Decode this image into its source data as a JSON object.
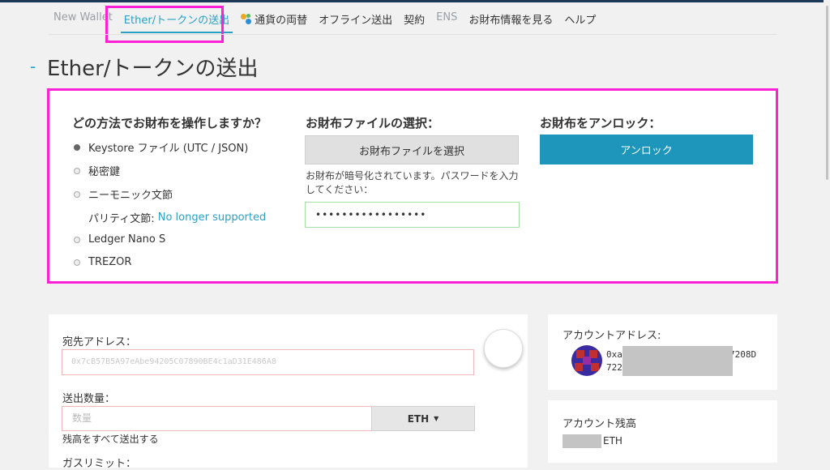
{
  "nav": {
    "items": [
      {
        "label": "New Wallet",
        "style": "muted"
      },
      {
        "label": "Ether/トークンの送出",
        "style": "active"
      },
      {
        "label": "通貨の両替",
        "style": "swap"
      },
      {
        "label": "オフライン送出",
        "style": "normal"
      },
      {
        "label": "契約",
        "style": "normal"
      },
      {
        "label": "ENS",
        "style": "muted"
      },
      {
        "label": "お財布情報を見る",
        "style": "normal"
      },
      {
        "label": "ヘルプ",
        "style": "normal"
      }
    ]
  },
  "page": {
    "dash": "-",
    "title": "Ether/トークンの送出"
  },
  "unlock": {
    "method_heading": "どの方法でお財布を操作しますか？",
    "options": [
      {
        "label": "Keystore ファイル (UTC / JSON)",
        "selected": true
      },
      {
        "label": "秘密鍵",
        "selected": false
      },
      {
        "label": "ニーモニック文節",
        "selected": false
      },
      {
        "label": "Ledger Nano S",
        "selected": false
      },
      {
        "label": "TREZOR",
        "selected": false
      }
    ],
    "parity_label": "パリティ文節:",
    "parity_link": "No longer supported",
    "file_heading": "お財布ファイルの選択：",
    "file_button": "お財布ファイルを選択",
    "password_hint": "お財布が暗号化されています。パスワードを入力してください：",
    "password_value": "•••••••••••••••••",
    "unlock_heading": "お財布をアンロック：",
    "unlock_button": "アンロック",
    "accent_color": "#1e96bb"
  },
  "send": {
    "to_label": "宛先アドレス：",
    "to_placeholder": "0x7cB57B5A97eAbe94205C07890BE4c1aD31E486A8",
    "amount_label": "送出数量：",
    "amount_placeholder": "数量",
    "unit": "ETH",
    "send_all": "残高をすべて送出する",
    "gas_label": "ガスリミット："
  },
  "account": {
    "address_label": "アカウントアドレス:",
    "address_line1_start": "0xa",
    "address_line1_end": "7208D",
    "address_line2_start": "722",
    "balance_label": "アカウント残高",
    "balance_unit": "ETH"
  },
  "icons": [
    "swap-icon",
    "chevron-down-icon",
    "identicon-avatar"
  ],
  "highlight_color": "#ff1fd5"
}
